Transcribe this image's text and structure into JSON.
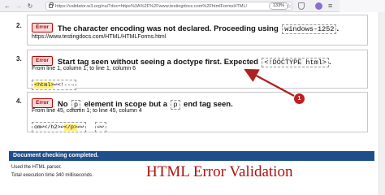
{
  "browser": {
    "back_icon": "←",
    "forward_icon": "→",
    "reload_icon": "↻",
    "url": "https://validator.w3.org/nu/?doc=https%3A%2F%2Fwww.testingdocs.com%2FhtmlFormsHTML/",
    "zoom": "133%"
  },
  "messages": [
    {
      "number": "2.",
      "badge": "Error",
      "text_before": "The character encoding was not declared. Proceeding using",
      "code": "windows-1252",
      "text_after": ".",
      "link": "https://www.testingdocs.com/HTML/HTMLForms.html"
    },
    {
      "number": "3.",
      "badge": "Error",
      "text_before": "Start tag seen without seeing a doctype first. Expected",
      "code": "<!DOCTYPE html>",
      "text_after": ".",
      "location": "From line 1, column 1; to line 1, column 6",
      "snippet_hl": "<html>",
      "snippet_rest": "↩<!--→"
    },
    {
      "number": "4.",
      "badge": "Error",
      "text_no": "No",
      "code1": "p",
      "text_mid": "element in scope but a",
      "code2": "p",
      "text_end": "end tag seen.",
      "location": "From line 45, column 1; to line 45, column 4",
      "snippet_pre": "om↩</h2>↩",
      "snippet_hl": "</p>",
      "snippet_post": "↩↩",
      "snippet2": "↩↩"
    }
  ],
  "callout": "1",
  "status_bar": "Document checking completed.",
  "footer": {
    "parser": "Used the HTML parser.",
    "time": "Total execution time 340 milliseconds."
  },
  "caption": "HTML Error Validation",
  "colors": {
    "error_red": "#b00000",
    "status_blue": "#1f4f8a",
    "caption_red": "#b01010",
    "highlight": "#ffef7a"
  }
}
